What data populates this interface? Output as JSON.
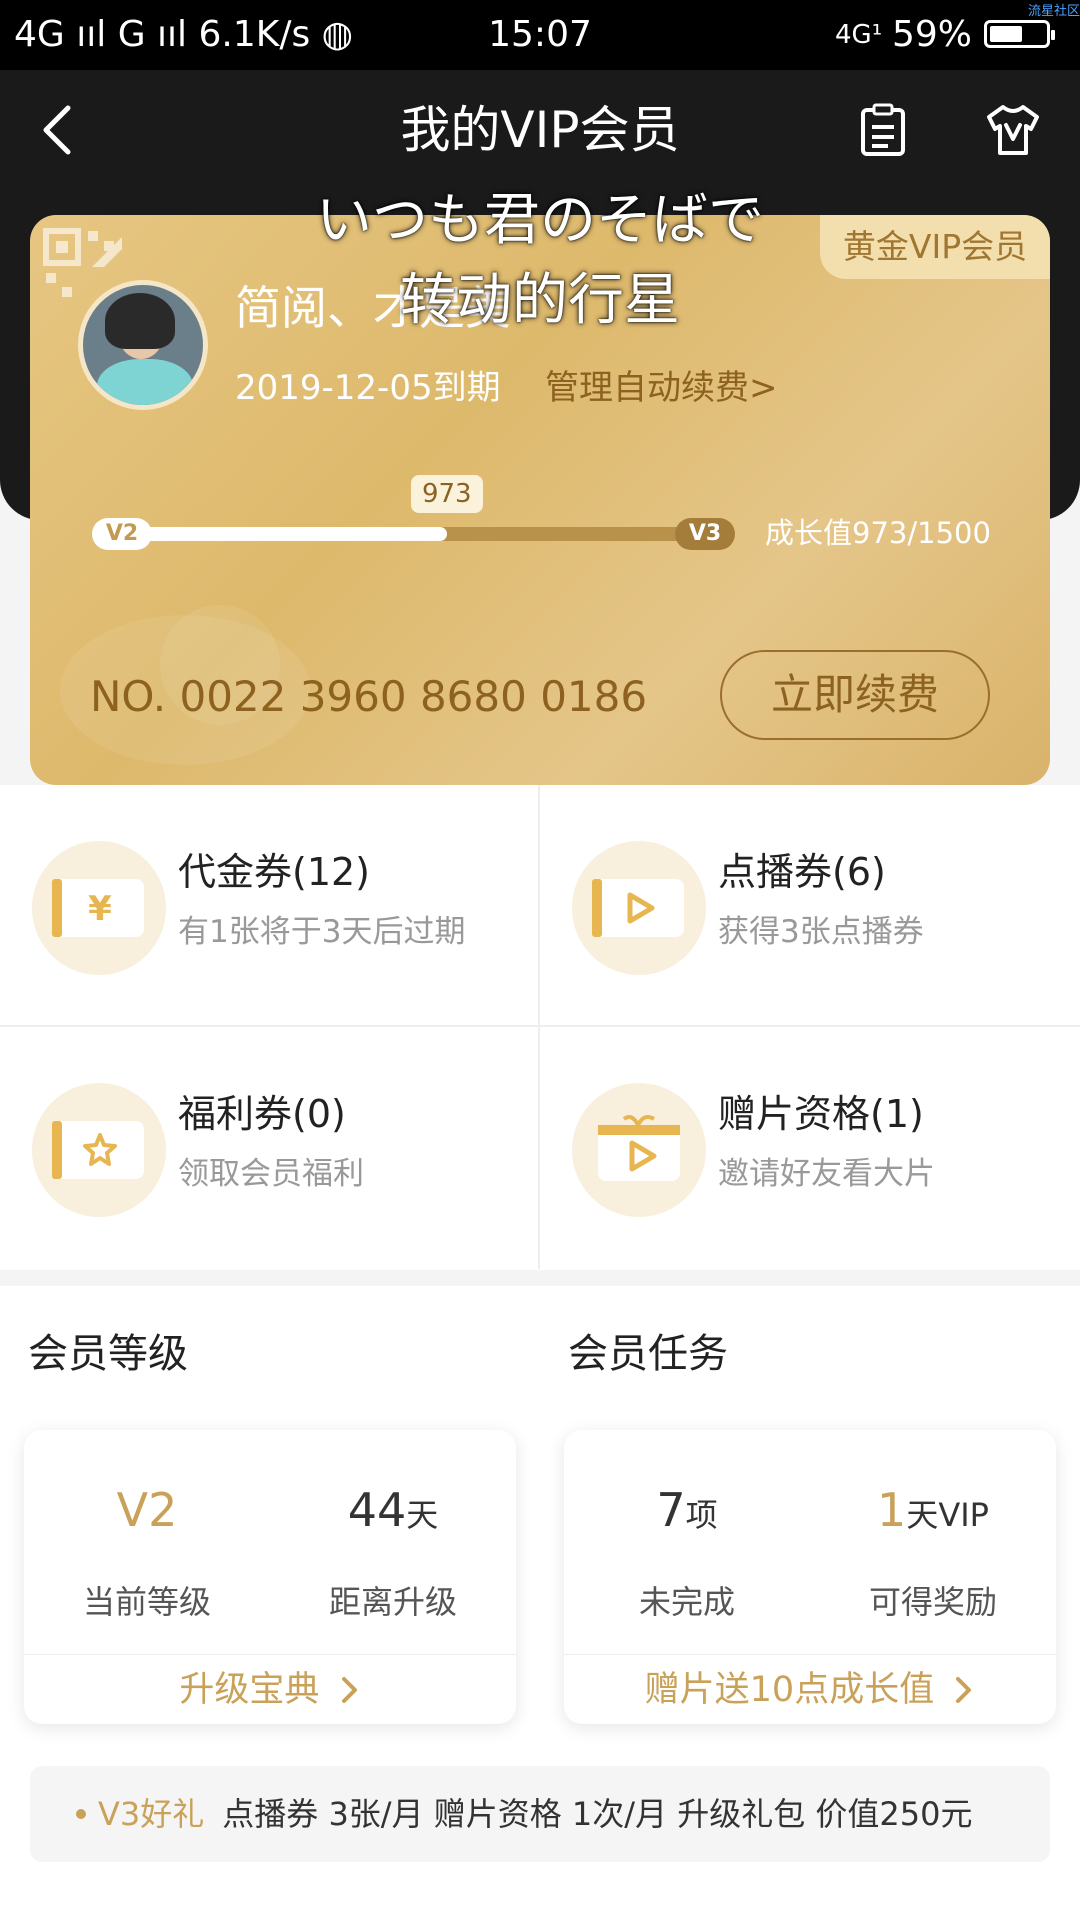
{
  "status_bar": {
    "left": "4G ııl G ııl 6.1K/s ◍",
    "time": "15:07",
    "network": "4G¹",
    "battery": "59%",
    "battery_level": 0.59,
    "corner_tag": "流星社区"
  },
  "header": {
    "title": "我的VIP会员"
  },
  "overlay": {
    "line1": "いつも君のそばで",
    "line2": "转动的行星"
  },
  "vip_card": {
    "tier": "黄金VIP会员",
    "user_name": "简阅、才是美",
    "expire": "2019-12-05到期",
    "auto_renew": "管理自动续费>",
    "level_current": "V2",
    "level_next": "V3",
    "progress_value": "973",
    "progress_fraction": 0.578,
    "growth": "成长值973/1500",
    "card_number": "NO. 0022 3960 8680 0186",
    "renew_button": "立即续费"
  },
  "coupons": [
    {
      "title": "代金券(12)",
      "subtitle": "有1张将于3天后过期",
      "icon": "yen-ticket-icon"
    },
    {
      "title": "点播券(6)",
      "subtitle": "获得3张点播券",
      "icon": "play-ticket-icon"
    },
    {
      "title": "福利券(0)",
      "subtitle": "领取会员福利",
      "icon": "star-ticket-icon"
    },
    {
      "title": "赠片资格(1)",
      "subtitle": "邀请好友看大片",
      "icon": "gift-play-icon"
    }
  ],
  "member_level": {
    "title": "会员等级",
    "current_level": "V2",
    "current_label": "当前等级",
    "days_value": "44",
    "days_unit": "天",
    "days_label": "距离升级",
    "link": "升级宝典"
  },
  "member_task": {
    "title": "会员任务",
    "count_value": "7",
    "count_unit": "项",
    "count_label": "未完成",
    "reward_value": "1",
    "reward_unit": "天VIP",
    "reward_label": "可得奖励",
    "link": "赠片送10点成长值"
  },
  "gift": {
    "title": "V3好礼",
    "items": "点播券 3张/月  赠片资格 1次/月  升级礼包 价值250元"
  },
  "colors": {
    "gold": "#c9a159",
    "card": "#e2c07c",
    "dark": "#1a1a1a"
  }
}
